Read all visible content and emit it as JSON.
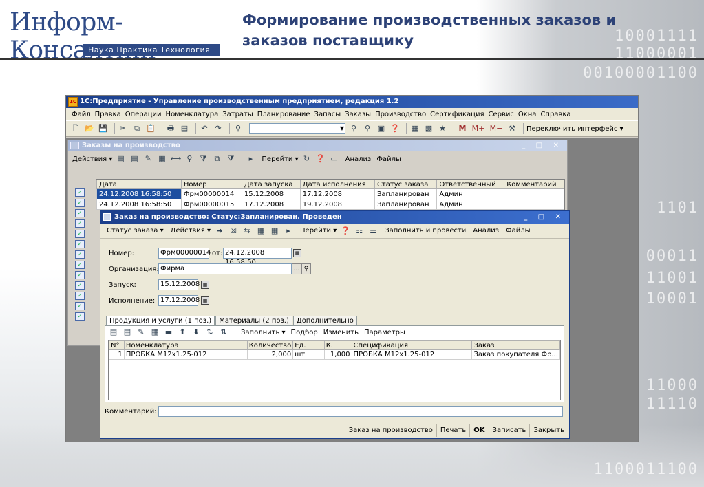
{
  "slide": {
    "logo_text": "Информ-Консалтинг",
    "logo_tagline": "Наука  Практика  Технология",
    "title": "Формирование производственных заказов и заказов поставщику",
    "binary_decor": [
      "10001111",
      "11000001",
      "00100001100",
      "1101",
      "00011",
      "11001",
      "10001",
      "11000",
      "11110",
      "1100011100"
    ]
  },
  "app": {
    "title": "1С:Предприятие - Управление производственным предприятием, редакция 1.2",
    "menu": [
      "Файл",
      "Правка",
      "Операции",
      "Номенклатура",
      "Затраты",
      "Планирование",
      "Запасы",
      "Заказы",
      "Производство",
      "Сертификация",
      "Сервис",
      "Окна",
      "Справка"
    ],
    "switch_interface": "Переключить интерфейс ▾"
  },
  "list_window": {
    "title": "Заказы на производство",
    "controls": "_ □ ✕",
    "toolbar": {
      "actions": "Действия ▾",
      "goto": "Перейти ▾",
      "analysis": "Анализ",
      "files": "Файлы"
    },
    "columns": [
      "Дата",
      "Номер",
      "Дата запуска",
      "Дата исполнения",
      "Статус заказа",
      "Ответственный",
      "Комментарий"
    ],
    "rows": [
      [
        "24.12.2008 16:58:50",
        "Фрм00000014",
        "15.12.2008",
        "17.12.2008",
        "Запланирован",
        "Админ",
        ""
      ],
      [
        "24.12.2008 16:58:50",
        "Фрм00000015",
        "17.12.2008",
        "19.12.2008",
        "Запланирован",
        "Админ",
        ""
      ]
    ]
  },
  "form": {
    "title": "Заказ на производство: Статус:Запланирован. Проведен",
    "controls": "_ □ ✕",
    "toolbar": {
      "status": "Статус заказа ▾",
      "actions": "Действия ▾",
      "goto": "Перейти ▾",
      "fill_post": "Заполнить и провести",
      "analysis": "Анализ",
      "files": "Файлы"
    },
    "number_label": "Номер:",
    "number_value": "Фрм00000014",
    "from_label": "от:",
    "date_value": "24.12.2008 16:58:50",
    "org_label": "Организация:",
    "org_value": "Фирма",
    "launch_label": "Запуск:",
    "launch_value": "15.12.2008",
    "exec_label": "Исполнение:",
    "exec_value": "17.12.2008",
    "tabs": [
      "Продукция и услуги (1 поз.)",
      "Материалы (2 поз.)",
      "Дополнительно"
    ],
    "panel_toolbar": {
      "fill": "Заполнить ▾",
      "pick": "Подбор",
      "change": "Изменить",
      "params": "Параметры"
    },
    "columns": [
      "N°",
      "Номенклатура",
      "Количество",
      "Ед.",
      "К.",
      "Спецификация",
      "Заказ"
    ],
    "rows": [
      [
        "1",
        "ПРОБКА М12x1.25-012",
        "2,000",
        "шт",
        "1,000",
        "ПРОБКА М12x1.25-012",
        "Заказ покупателя Фр..."
      ]
    ],
    "comment_label": "Комментарий:",
    "footer": [
      "Заказ на производство",
      "Печать",
      "OK",
      "Записать",
      "Закрыть"
    ]
  }
}
